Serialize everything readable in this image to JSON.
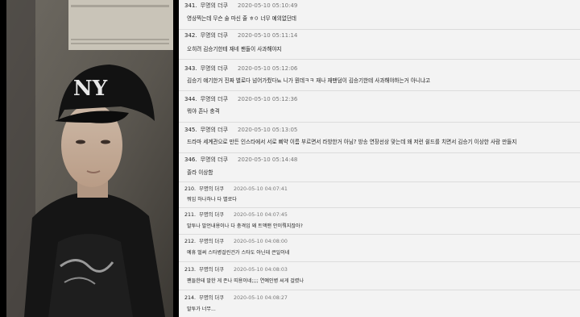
{
  "photo": {
    "description_icon": "person-in-cap-icon"
  },
  "comments": [
    {
      "num": "341.",
      "nick": "무명의 더쿠",
      "date": "2020-05-10 05:10:49",
      "text": "영상찍는데 무슨 술 마신 줄 ㅎㅇ 너무 예의없던데"
    },
    {
      "num": "342.",
      "nick": "무명의 더쿠",
      "date": "2020-05-10 05:11:14",
      "text": "오히려 김승기한테 재네 팬들이 사과해야지"
    },
    {
      "num": "343.",
      "nick": "무명의 더쿠",
      "date": "2020-05-10 05:12:06",
      "text": "김승기 얘기한거 진짜 별로다 넘어가줬다뇨 니가 뭔데ㅋㅋ 재나 재팬덤이 김승기한테 사과해야하는거 아니냐고"
    },
    {
      "num": "344.",
      "nick": "무명의 더쿠",
      "date": "2020-05-10 05:12:36",
      "text": "뭐야 존나 충격"
    },
    {
      "num": "345.",
      "nick": "무명의 더쿠",
      "date": "2020-05-10 05:13:05",
      "text": "드라마 세계관으로 만든 인스타에서 서로 삐약 이름 부르면서 라방한거 아님? 방송 연장선상 맞는데 왜 저런 쉴드를 치면서 김승기 이상한 사람 만들지"
    },
    {
      "num": "346.",
      "nick": "무명의 더쿠",
      "date": "2020-05-10 05:14:48",
      "text": "졸라 이상함"
    },
    {
      "num": "210.",
      "nick": "무명의 더쿠",
      "date": "2020-05-10 04:07:41",
      "text": "뭐임 하나하나 다 별로다"
    },
    {
      "num": "211.",
      "nick": "무명의 더쿠",
      "date": "2020-05-10 04:07:45",
      "text": "말투나 발언내용이나 다 충격임 왜 트액맨 안이뤄지잖아?"
    },
    {
      "num": "212.",
      "nick": "무명의 더쿠",
      "date": "2020-05-10 04:08:00",
      "text": "예휴 벌써 스타병걸린건가 스타도 아닌데 큰일이네"
    },
    {
      "num": "213.",
      "nick": "무명의 더쿠",
      "date": "2020-05-10 04:08:03",
      "text": "팬들한테 말한 게 존나 띠용이네;;;; 연예인병 씨게 걸렸나"
    },
    {
      "num": "214.",
      "nick": "무명의 더쿠",
      "date": "2020-05-10 04:08:27",
      "text": "말투가 너무..."
    }
  ],
  "colors": {
    "board_bg": "#f3f3f3",
    "divider": "#dcdcdc",
    "date": "#777777",
    "photo_bg": "#000000"
  }
}
